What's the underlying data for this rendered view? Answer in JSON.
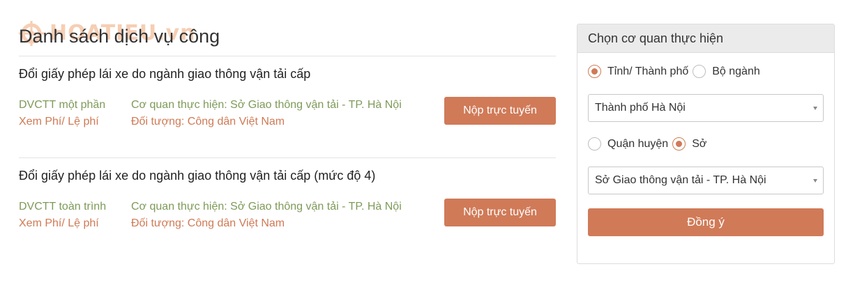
{
  "page_title": "Danh sách dịch vụ công",
  "watermark_text": "HOATIEU.vn",
  "services": [
    {
      "title": "Đổi giấy phép lái xe do ngành giao thông vận tải cấp",
      "level": "DVCTT một phần",
      "fee_link": "Xem Phí/ Lệ phí",
      "agency": "Cơ quan thực hiện: Sở Giao thông vận tải - TP. Hà Nội",
      "target": "Đối tượng: Công dân Việt Nam",
      "submit_label": "Nộp trực tuyến"
    },
    {
      "title": "Đổi giấy phép lái xe do ngành giao thông vận tải cấp (mức độ 4)",
      "level": "DVCTT toàn trình",
      "fee_link": "Xem Phí/ Lệ phí",
      "agency": "Cơ quan thực hiện: Sở Giao thông vận tải - TP. Hà Nội",
      "target": "Đối tượng: Công dân Việt Nam",
      "submit_label": "Nộp trực tuyến"
    }
  ],
  "panel": {
    "title": "Chọn cơ quan thực hiện",
    "radio_group_1": [
      {
        "label": "Tỉnh/ Thành phố",
        "checked": true
      },
      {
        "label": "Bộ ngành",
        "checked": false
      }
    ],
    "select_1": {
      "value": "Thành phố Hà Nội"
    },
    "radio_group_2": [
      {
        "label": "Quận huyện",
        "checked": false
      },
      {
        "label": "Sở",
        "checked": true
      }
    ],
    "select_2": {
      "value": "Sở Giao thông vận tải - TP. Hà Nội"
    },
    "confirm_label": "Đồng ý"
  },
  "colors": {
    "accent": "#d07a58",
    "green_text": "#7e9a59",
    "orange_text": "#cf7a55",
    "panel_header_bg": "#ebebeb"
  }
}
